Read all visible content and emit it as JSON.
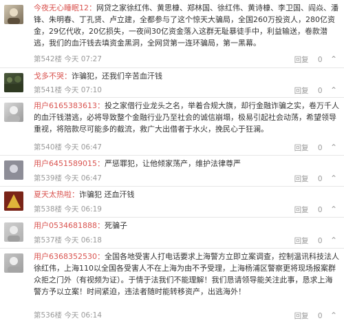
{
  "comments": [
    {
      "user": "今夜无心睡眠12：",
      "text": "网贷之家徐红伟、黄思槺、郑林国、徐红伟、黄诗槺、李卫国、阎焱、潘锋、朱明春、丁孔贤、卢立建，全都参与了这个惊天大骗局，全国260万投资人，280亿资金，29亿代收，20亿损失，一夜间30亿资金落入这群无耻暴徒手中，利益输送，卷款潜逃，我们的血汗钱去填资金黑洞，全网贷第一连环骗局，第一黑幕。",
      "floor": "第542楼 今天 07:27",
      "report": "回复",
      "likes": "0"
    },
    {
      "user": "戈多不哭：",
      "text": "诈骗犯，还我们辛苦血汗钱",
      "floor": "第541楼 今天 07:10",
      "report": "回复",
      "likes": "0"
    },
    {
      "user": "用户6165383613：",
      "text": "投之家借行业龙头之名，举着合规大旗，却行金融诈骗之实，卷万千人的血汗钱潜逃，必将导致整个金融行业乃至社会的诚信崩塌，极易引起社会动荡，希望领导重视，将陪款尽可能多的截流，救广大出借者于水火，挽民心于狂澜。",
      "floor": "第540楼 今天 06:47",
      "report": "回复",
      "likes": "0"
    },
    {
      "user": "用户6451589015：",
      "text": "严惩罪犯，让他倾家荡产，维护法律尊严",
      "floor": "第539楼 今天 06:47",
      "report": "回复",
      "likes": "0"
    },
    {
      "user": "夏天太热啦：",
      "text": "诈骗犯 还血汗钱",
      "floor": "第538楼 今天 06:19",
      "report": "回复",
      "likes": "0"
    },
    {
      "user": "用户0534681888：",
      "text": "死骗子",
      "floor": "第537楼 今天 06:18",
      "report": "回复",
      "likes": "0"
    },
    {
      "user": "用户6368352530：",
      "text": "全国各地受害人打电话要求上海警方立即立案调查，控制温讯科技法人徐红伟，上海110以全国各受害人不在上海为由不予受理，上海杨浦区警察更将现场报案群众拒之门外（有视频为证）。于情于法我们不能理解！我们恳请领导能关注此事，恳求上海警方予以立案！时间紧迫，违法者随时能转移资产，出逃海外！",
      "floor": "第536楼 今天 06:14",
      "report": "回复",
      "likes": "0"
    }
  ]
}
